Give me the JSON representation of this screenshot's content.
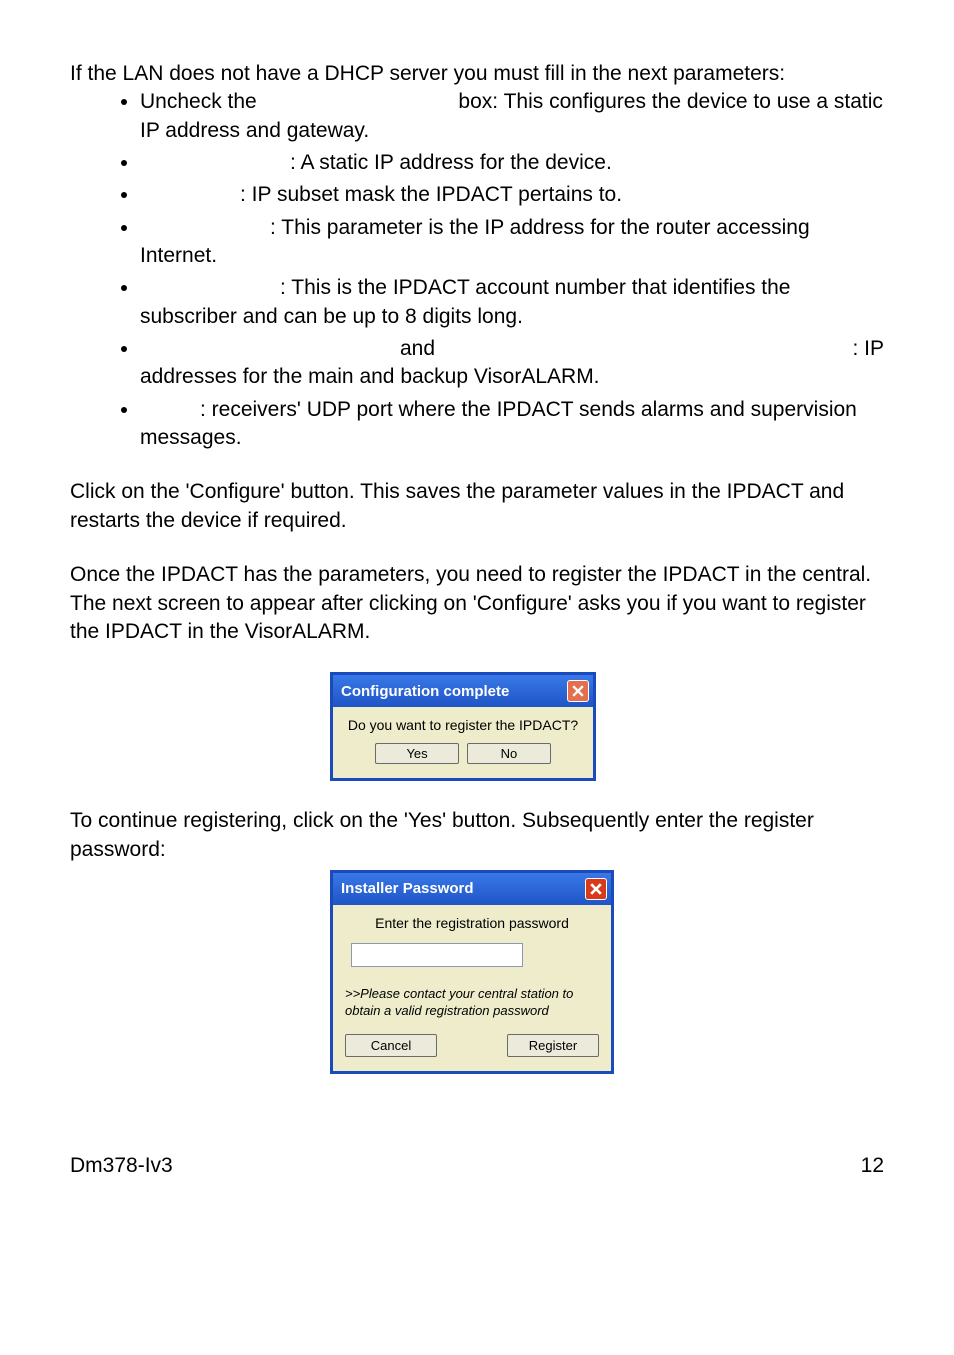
{
  "intro": "If the LAN does not have a DHCP server you must fill in the next parameters:",
  "bullets": {
    "b1a": "Uncheck the",
    "b1b": "box: This configures the device to use a static IP address and gateway.",
    "b2": ": A static IP address for the device.",
    "b3": ": IP subset mask the IPDACT pertains to.",
    "b4": ": This parameter is the IP address for the router accessing Internet.",
    "b5": ": This is the IPDACT account number that identifies the subscriber and can be up to 8 digits long.",
    "b6a": "and",
    "b6b": ": IP",
    "b6c": "addresses for the main and backup VisorALARM.",
    "b7": ": receivers' UDP port where the IPDACT sends alarms and supervision messages."
  },
  "para2": "Click on the 'Configure' button.  This saves the parameter values in the IPDACT and restarts the device if required.",
  "para3": "Once the IPDACT has the parameters, you need to register the IPDACT in the central.  The next screen to appear after clicking on 'Configure' asks you if you want to register the IPDACT in the VisorALARM.",
  "dialog1": {
    "title": "Configuration complete",
    "message": "Do you want to register the IPDACT?",
    "yes": "Yes",
    "no": "No"
  },
  "para4": "To continue registering, click on the 'Yes' button.  Subsequently enter the register password:",
  "dialog2": {
    "title": "Installer Password",
    "instr": "Enter the registration password",
    "note": ">>Please contact your central station to obtain a valid registration password",
    "cancel": "Cancel",
    "register": "Register"
  },
  "footer": {
    "left": "Dm378-Iv3",
    "right": "12"
  }
}
